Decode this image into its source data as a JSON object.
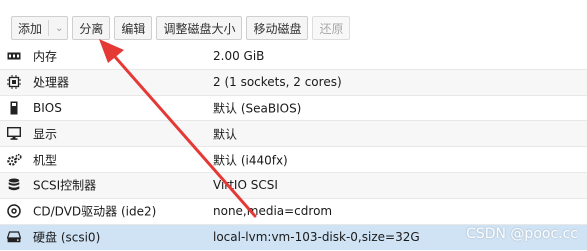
{
  "toolbar": {
    "add": "添加",
    "detach": "分离",
    "edit": "编辑",
    "resize": "调整磁盘大小",
    "move": "移动磁盘",
    "revert": "还原"
  },
  "rows": [
    {
      "icon": "memory-icon",
      "name": "内存",
      "value": "2.00 GiB"
    },
    {
      "icon": "cpu-icon",
      "name": "处理器",
      "value": "2 (1 sockets, 2 cores)"
    },
    {
      "icon": "bios-icon",
      "name": "BIOS",
      "value": "默认 (SeaBIOS)"
    },
    {
      "icon": "monitor-icon",
      "name": "显示",
      "value": "默认"
    },
    {
      "icon": "gears-icon",
      "name": "机型",
      "value": "默认 (i440fx)"
    },
    {
      "icon": "database-icon",
      "name": "SCSI控制器",
      "value": "VirtIO SCSI"
    },
    {
      "icon": "cdrom-icon",
      "name": "CD/DVD驱动器 (ide2)",
      "value": "none,media=cdrom"
    },
    {
      "icon": "hard-disk-icon",
      "name": "硬盘 (scsi0)",
      "value": "local-lvm:vm-103-disk-0,size=32G"
    }
  ],
  "watermark": "CSDN @pooc.cc",
  "colors": {
    "selected_row": "#cfe3f5",
    "arrow": "#e53935"
  }
}
